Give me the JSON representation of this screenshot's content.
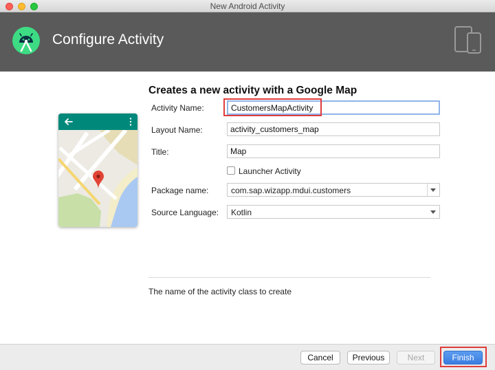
{
  "window": {
    "title": "New Android Activity"
  },
  "header": {
    "title": "Configure Activity",
    "logo_icon": "android-studio-icon",
    "device_icon": "devices-icon"
  },
  "form": {
    "heading": "Creates a new activity with a Google Map",
    "activity_name": {
      "label": "Activity Name:",
      "value": "CustomersMapActivity"
    },
    "layout_name": {
      "label": "Layout Name:",
      "value": "activity_customers_map"
    },
    "title": {
      "label": "Title:",
      "value": "Map"
    },
    "launcher": {
      "label": "Launcher Activity",
      "checked": false
    },
    "package_name": {
      "label": "Package name:",
      "value": "com.sap.wizapp.mdui.customers"
    },
    "source_language": {
      "label": "Source Language:",
      "value": "Kotlin"
    }
  },
  "help_text": "The name of the activity class to create",
  "buttons": {
    "cancel": "Cancel",
    "previous": "Previous",
    "next": "Next",
    "finish": "Finish"
  },
  "colors": {
    "highlight": "#e03c3c",
    "android_green": "#3ddc84",
    "appbar_teal": "#00897b"
  }
}
